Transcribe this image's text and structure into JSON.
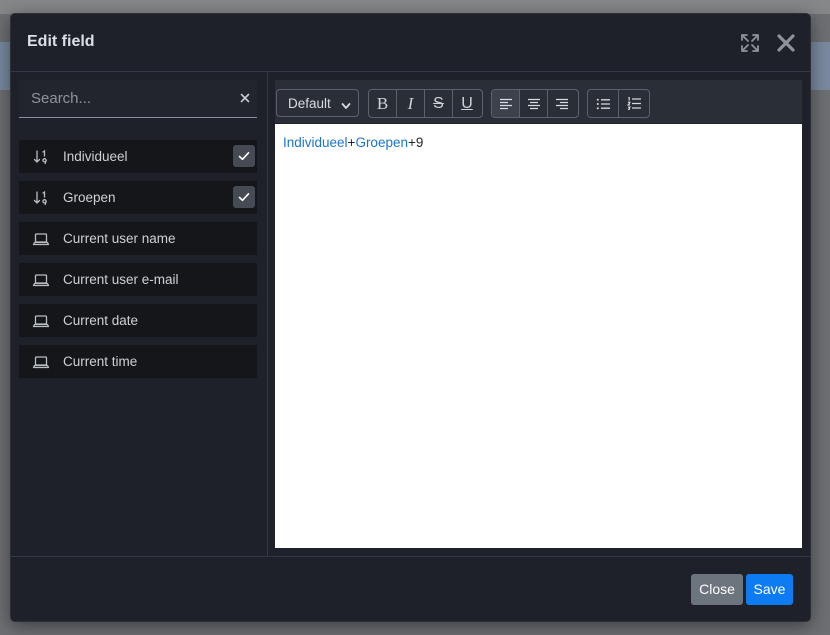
{
  "modal": {
    "title": "Edit field",
    "icons": {
      "expand": "expand-arrows-icon",
      "close": "close-x-icon"
    }
  },
  "search": {
    "placeholder": "Search...",
    "value": ""
  },
  "fields": [
    {
      "label": "Individueel",
      "icon": "sort-numeric-icon",
      "checked": true
    },
    {
      "label": "Groepen",
      "icon": "sort-numeric-icon",
      "checked": true
    },
    {
      "label": "Current user name",
      "icon": "laptop-icon",
      "checked": false
    },
    {
      "label": "Current user e-mail",
      "icon": "laptop-icon",
      "checked": false
    },
    {
      "label": "Current date",
      "icon": "laptop-icon",
      "checked": false
    },
    {
      "label": "Current time",
      "icon": "laptop-icon",
      "checked": false
    }
  ],
  "toolbar": {
    "font_size": "Default",
    "format": [
      "B",
      "I",
      "S",
      "U"
    ],
    "align": [
      "align-left-icon",
      "align-center-icon",
      "align-right-icon"
    ],
    "active_align": "align-left-icon",
    "lists": [
      "bullet-list-icon",
      "numbered-list-icon"
    ]
  },
  "editor": {
    "tokens": [
      {
        "text": "Individueel",
        "kind": "field"
      },
      {
        "text": "+",
        "kind": "plain"
      },
      {
        "text": "Groepen",
        "kind": "field"
      },
      {
        "text": "+9",
        "kind": "plain"
      }
    ]
  },
  "footer": {
    "close_label": "Close",
    "save_label": "Save"
  },
  "colors": {
    "accent": "#0d7cf2",
    "field_token": "#1b75d0",
    "modal_bg": "#1e2129"
  }
}
